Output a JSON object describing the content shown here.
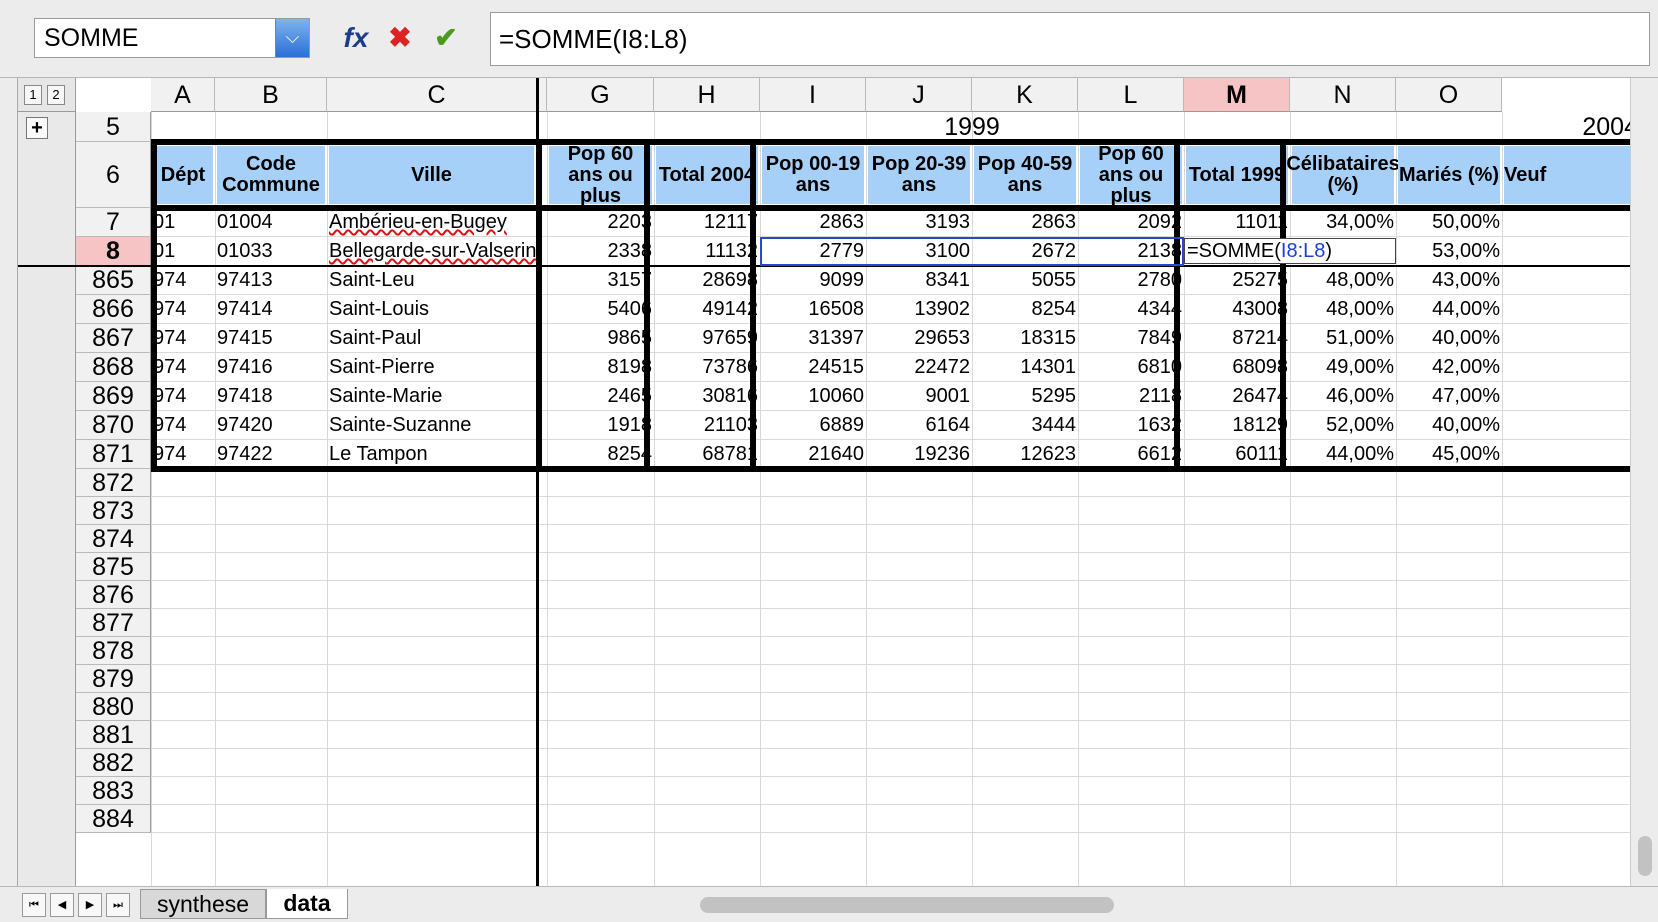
{
  "name_box": {
    "value": "SOMME"
  },
  "formula": {
    "value": "=SOMME(I8:L8)"
  },
  "outline_levels": [
    "1",
    "2"
  ],
  "outline_expand": "+",
  "columns": [
    "A",
    "B",
    "C",
    "G",
    "H",
    "I",
    "J",
    "K",
    "L",
    "M",
    "N",
    "O"
  ],
  "selected_column": "M",
  "row5": {
    "num": "5",
    "year1": "1999",
    "year2": "2004"
  },
  "header_row": {
    "num": "6",
    "cells": [
      "Dépt",
      "Code Commune",
      "Ville",
      "Pop 60 ans ou plus",
      "Total 2004",
      "Pop 00-19 ans",
      "Pop 20-39 ans",
      "Pop 40-59 ans",
      "Pop 60 ans ou plus",
      "Total 1999",
      "Célibataires (%)",
      "Mariés (%)",
      "Veuf"
    ]
  },
  "data_rows": [
    {
      "num": "7",
      "cells": [
        "01",
        "01004",
        "Ambérieu-en-Bugey",
        "2203",
        "12117",
        "2863",
        "3193",
        "2863",
        "2092",
        "11011",
        "34,00%",
        "50,00%"
      ]
    },
    {
      "num": "8",
      "cells": [
        "01",
        "01033",
        "Bellegarde-sur-Valserine",
        "2338",
        "11132",
        "2779",
        "3100",
        "2672",
        "2138",
        "",
        "",
        "53,00%"
      ]
    },
    {
      "num": "865",
      "cells": [
        "974",
        "97413",
        "Saint-Leu",
        "3157",
        "28698",
        "9099",
        "8341",
        "5055",
        "2780",
        "25275",
        "48,00%",
        "43,00%"
      ]
    },
    {
      "num": "866",
      "cells": [
        "974",
        "97414",
        "Saint-Louis",
        "5406",
        "49142",
        "16508",
        "13902",
        "8254",
        "4344",
        "43008",
        "48,00%",
        "44,00%"
      ]
    },
    {
      "num": "867",
      "cells": [
        "974",
        "97415",
        "Saint-Paul",
        "9865",
        "97659",
        "31397",
        "29653",
        "18315",
        "7849",
        "87214",
        "51,00%",
        "40,00%"
      ]
    },
    {
      "num": "868",
      "cells": [
        "974",
        "97416",
        "Saint-Pierre",
        "8198",
        "73786",
        "24515",
        "22472",
        "14301",
        "6810",
        "68098",
        "49,00%",
        "42,00%"
      ]
    },
    {
      "num": "869",
      "cells": [
        "974",
        "97418",
        "Sainte-Marie",
        "2465",
        "30816",
        "10060",
        "9001",
        "5295",
        "2118",
        "26474",
        "46,00%",
        "47,00%"
      ]
    },
    {
      "num": "870",
      "cells": [
        "974",
        "97420",
        "Sainte-Suzanne",
        "1918",
        "21103",
        "6889",
        "6164",
        "3444",
        "1632",
        "18129",
        "52,00%",
        "40,00%"
      ]
    },
    {
      "num": "871",
      "cells": [
        "974",
        "97422",
        "Le Tampon",
        "8254",
        "68781",
        "21640",
        "19236",
        "12623",
        "6612",
        "60111",
        "44,00%",
        "45,00%"
      ]
    }
  ],
  "edit_cell": {
    "prefix": "=SOMME(",
    "ref": "I8:L8",
    "suffix": ")"
  },
  "empty_rows": [
    "872",
    "873",
    "874",
    "875",
    "876",
    "877",
    "878",
    "879",
    "880",
    "881",
    "882",
    "883",
    "884"
  ],
  "sheet_tabs": [
    {
      "label": "synthese",
      "active": false
    },
    {
      "label": "data",
      "active": true
    }
  ],
  "nav_buttons": [
    "first-sheet",
    "prev-sheet",
    "next-sheet",
    "last-sheet"
  ],
  "colors": {
    "header_fill": "#a6d0f7",
    "selected_header": "#f6c4c4",
    "ref_text": "#1a3fd6"
  }
}
